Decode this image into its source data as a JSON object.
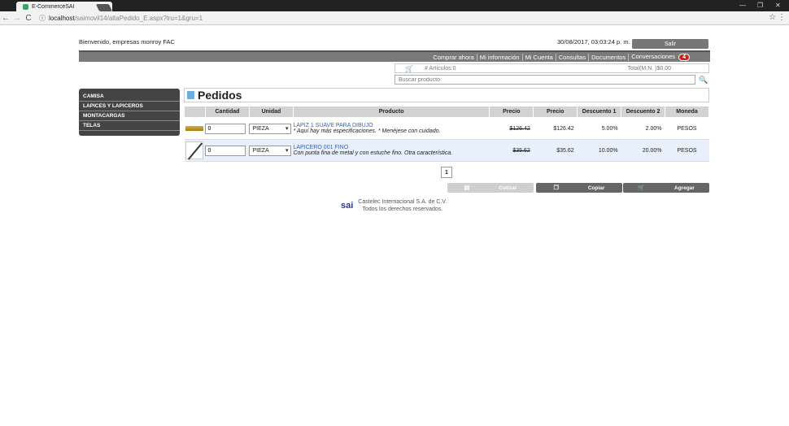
{
  "browser": {
    "tab_title": "E-CommerceSAI",
    "tab_close": "×",
    "url_host": "localhost",
    "url_path": "/saimovil14/altaPedido_E.aspx?lru=1&gru=1",
    "info_icon": "ⓘ",
    "back": "←",
    "forward": "→",
    "reload": "C",
    "star": "☆",
    "menu": "⋮",
    "minimize": "—",
    "maximize": "❐",
    "close": "✕"
  },
  "header": {
    "welcome": "Bienvenido, empresas monroy FAC",
    "datetime": "30/08/2017, 03:03:24 p. m.",
    "logout_label": "Salir"
  },
  "nav": {
    "items": [
      "Comprar ahora",
      "Mi información",
      "Mi Cuenta",
      "Consultas",
      "Documentos",
      "Conversaciones"
    ],
    "badge": "4"
  },
  "cart": {
    "icon": "🛒",
    "articles": "# Artículos:0",
    "total": "Total(M.N. )$0.00"
  },
  "search": {
    "placeholder": "Buscar producto",
    "icon": "🔍"
  },
  "sidebar": {
    "items": [
      "CAMISA",
      "LAPICES Y LAPICEROS",
      "MONTACARGAS",
      "TELAS"
    ]
  },
  "main": {
    "title": "Pedidos",
    "columns": [
      "",
      "Cantidad",
      "Unidad",
      "Producto",
      "Precio",
      "Precio",
      "Descuento 1",
      "Descuento 2",
      "Moneda"
    ],
    "rows": [
      {
        "qty": "0",
        "unit": "PIEZA",
        "name": "LAPIZ 1 SUAVE PARA DIBUJO",
        "desc": "* Aquí hay más especificaciones. * Menéjese con cuidado.",
        "price_old": "$126.42",
        "price": "$126.42",
        "disc1": "5.00%",
        "disc2": "2.00%",
        "currency": "PESOS"
      },
      {
        "qty": "0",
        "unit": "PIEZA",
        "name": "LAPICERO 001 FINO",
        "desc": "Con punta fina de metal y con estuche fino. Otra característica.",
        "price_old": "$35.62",
        "price": "$35.62",
        "disc1": "10.00%",
        "disc2": "20.00%",
        "currency": "PESOS"
      }
    ],
    "page": "1",
    "buttons": {
      "cotizar": "Cotizar",
      "copiar": "Copiar",
      "agregar": "Agregar"
    }
  },
  "footer": {
    "logo": "sai",
    "line1": "Castelec Internacional S.A. de C.V.",
    "line2": "Todos los derechos reservados."
  }
}
